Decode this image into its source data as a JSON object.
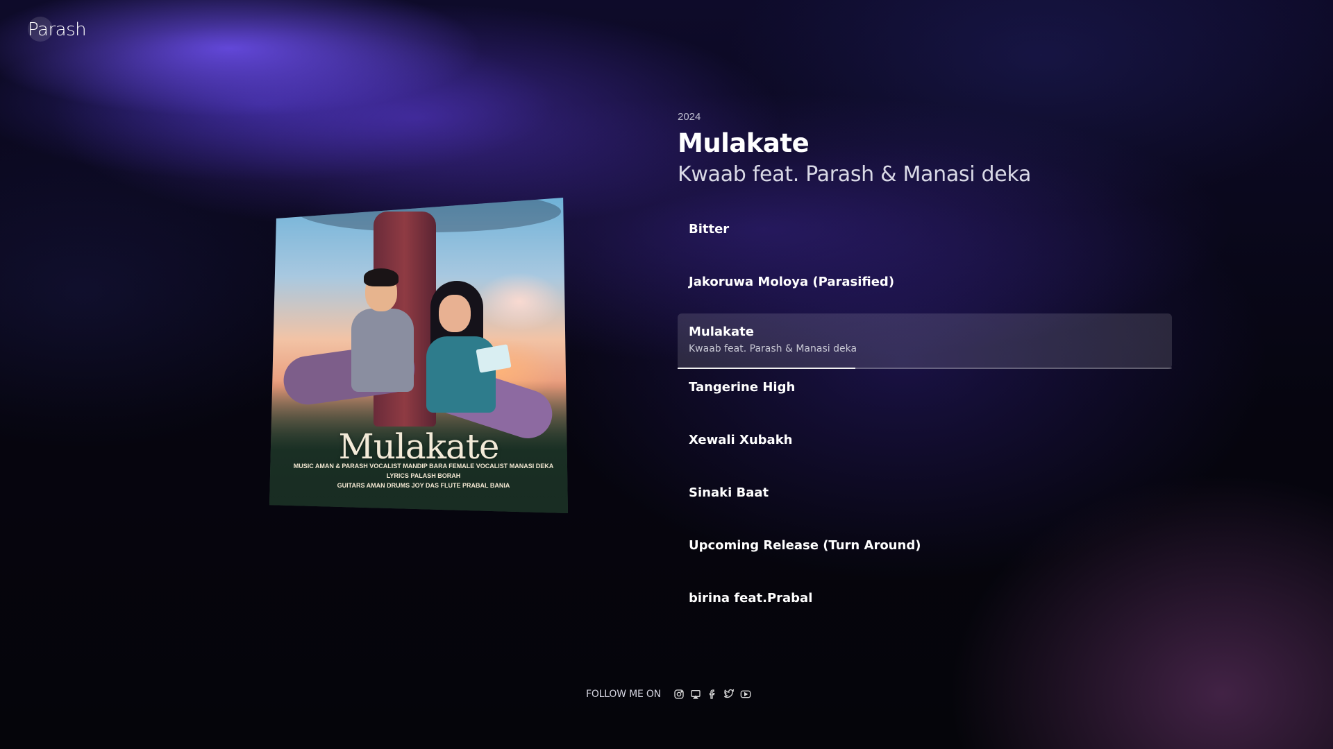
{
  "brand": {
    "name": "Parash"
  },
  "release": {
    "year": "2024",
    "title": "Mulakate",
    "artist": "Kwaab feat. Parash & Manasi deka"
  },
  "cover": {
    "title": "Mulakate",
    "credits_line1": "MUSIC AMAN & PARASH VOCALIST MANDIP BARA FEMALE VOCALIST MANASI DEKA LYRICS PALASH BORAH",
    "credits_line2": "GUITARS AMAN DRUMS JOY DAS FLUTE PRABAL BANIA"
  },
  "tracks": [
    {
      "name": "Bitter"
    },
    {
      "name": "Jakoruwa Moloya (Parasified)"
    },
    {
      "name": "Mulakate",
      "subtitle": "Kwaab feat. Parash & Manasi deka",
      "active": true,
      "progress": 0.36
    },
    {
      "name": "Tangerine High"
    },
    {
      "name": "Xewali Xubakh"
    },
    {
      "name": "Sinaki Baat"
    },
    {
      "name": "Upcoming Release (Turn Around)"
    },
    {
      "name": "birina feat.Prabal"
    }
  ],
  "footer": {
    "follow_label": "FOLLOW ME ON",
    "socials": [
      "instagram-icon",
      "airplay-icon",
      "facebook-icon",
      "twitter-icon",
      "youtube-icon"
    ]
  }
}
